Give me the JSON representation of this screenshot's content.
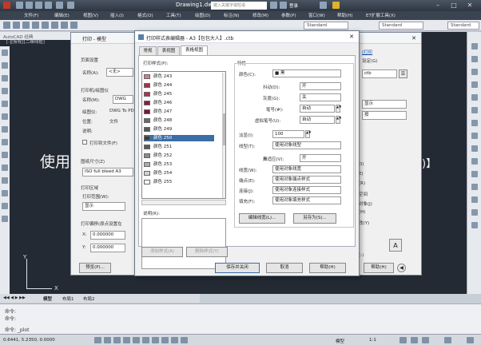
{
  "window": {
    "title": "Drawing1.dwg",
    "search_placeholder": "键入关键字或短语",
    "login": "登录"
  },
  "menu": [
    "文件(F)",
    "编辑(E)",
    "视图(V)",
    "插入(I)",
    "格式(O)",
    "工具(T)",
    "绘图(D)",
    "标注(N)",
    "修改(M)",
    "参数(P)",
    "窗口(W)",
    "帮助(H)",
    "ET扩展工具(X)"
  ],
  "toolbar": {
    "workspace": "AutoCAD 经典",
    "std1": "Standard",
    "std2": "Standard",
    "std3": "Standard"
  },
  "canvas": {
    "view_label": "[-][俯视][二维线框]",
    "big_text": "使用",
    "big_text_right": ")】",
    "ucs_y": "Y",
    "ucs_x": "X"
  },
  "plot_dialog": {
    "title": "打印 - 模型",
    "page_setup": "页面设置",
    "name_label": "名称(A):",
    "name_value": "<无>",
    "printer_group": "打印机/绘图仪",
    "printer_name_label": "名称(M):",
    "printer_name_value": "DWG",
    "plotter_label": "绘图仪:",
    "plotter_value": "DWG To PDF",
    "location_label": "位置:",
    "location_value": "文件",
    "desc_label": "说明:",
    "plot_to_file": "打印到文件(F)",
    "paper_size": "图纸尺寸(Z)",
    "paper_value": "ISO full bleed A3",
    "plot_area": "打印区域",
    "plot_range": "打印范围(W):",
    "plot_range_value": "显示",
    "plot_offset": "打印偏移(原点设置在",
    "x_label": "X:",
    "x_value": "0.000000",
    "y_label": "Y:",
    "y_value": "0.000000",
    "preview_btn": "预览(P)...",
    "right_link": "(打印",
    "right_a": "设定(G)",
    "right_combo": "ctb",
    "right_display": "显示",
    "right_fit": "按",
    "right_d": "D)",
    "right_e": "E)",
    "right_r": "(R)",
    "right_space": "空间",
    "right_obj": "对象(J)",
    "right_h": "(H)",
    "right_mod": "改(Y)",
    "right_dash": "(-)",
    "help_btn": "帮助(H)",
    "apply_btn": "A"
  },
  "ts_dialog": {
    "title": "打印样式表编辑器 - A3【包包大人】.ctb",
    "tabs": [
      "常规",
      "表视图",
      "表格视图"
    ],
    "styles_label": "打印样式(P):",
    "styles": [
      {
        "name": "颜色 243",
        "color": "#d97a8c"
      },
      {
        "name": "颜色 244",
        "color": "#a3324f"
      },
      {
        "name": "颜色 245",
        "color": "#b03354"
      },
      {
        "name": "颜色 246",
        "color": "#8c1c3a"
      },
      {
        "name": "颜色 247",
        "color": "#7a1830"
      },
      {
        "name": "颜色 248",
        "color": "#6b6b6b"
      },
      {
        "name": "颜色 249",
        "color": "#595959"
      },
      {
        "name": "颜色 250",
        "color": "#3b3b3b"
      },
      {
        "name": "颜色 251",
        "color": "#5b5b5b"
      },
      {
        "name": "颜色 252",
        "color": "#8a8a8a"
      },
      {
        "name": "颜色 253",
        "color": "#adadad"
      },
      {
        "name": "颜色 254",
        "color": "#d2d2d2"
      },
      {
        "name": "颜色 255",
        "color": "#ffffff"
      }
    ],
    "desc_label": "说明(R):",
    "props_label": "特性",
    "color_label": "颜色(C):",
    "color_value": "■ 黑",
    "dither_label": "抖动(D):",
    "dither_value": "开",
    "gray_label": "灰度(G):",
    "gray_value": "关",
    "pen_label": "笔号(#):",
    "pen_value": "自动",
    "vpen_label": "虚拟笔号(U):",
    "vpen_value": "自动",
    "density_label": "淡显(I):",
    "density_value": "100",
    "linetype_label": "线型(T):",
    "linetype_value": "使用对象线型",
    "adaptive_label": "自适应(V):",
    "adaptive_value": "开",
    "lineweight_label": "线宽(W):",
    "lineweight_value": "使用对象线宽",
    "endstyle_label": "端点(E):",
    "endstyle_value": "使用对象端点样式",
    "joinstyle_label": "连接(J):",
    "joinstyle_value": "使用对象连接样式",
    "fill_label": "填充(F):",
    "fill_value": "使用对象填充样式",
    "edit_lw_btn": "编辑线宽(L)...",
    "save_as_btn": "另存为(S)...",
    "add_btn": "添加样式(A)",
    "del_btn": "删除样式(Y)",
    "save_close_btn": "保存并关闭",
    "cancel_btn": "取消",
    "help_btn": "帮助(H)"
  },
  "layout_tabs": [
    "模型",
    "布局1",
    "布局2"
  ],
  "command": {
    "line1": "命令:",
    "line2": "命令:",
    "line3": "命令: _plot"
  },
  "status": {
    "coords": "0.6441, 5.2350, 0.0000",
    "model": "模型",
    "scale": "1:1"
  }
}
